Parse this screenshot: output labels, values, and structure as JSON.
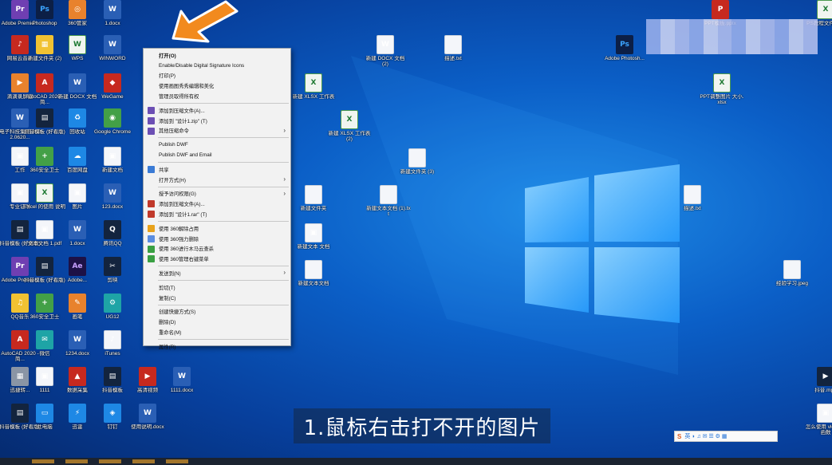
{
  "desktop_icons": [
    {
      "label": "Adobe Premie...",
      "glyph": "Pr",
      "style": "g-purple"
    },
    {
      "label": "网易云音乐",
      "glyph": "♪",
      "style": "g-red"
    },
    {
      "label": "滴滴录屏器",
      "glyph": "▶",
      "style": "g-orange"
    },
    {
      "label": "电子科技集团 2022.0620...",
      "glyph": "W",
      "style": "g-word"
    },
    {
      "label": "工作",
      "glyph": "▣",
      "style": "g-white"
    },
    {
      "label": "专业证书",
      "glyph": "▣",
      "style": "g-white"
    },
    {
      "label": "抖音模板 (好看版)",
      "glyph": "▤",
      "style": "g-dark"
    },
    {
      "label": "Adobe Premie...",
      "glyph": "Pr",
      "style": "g-purple"
    },
    {
      "label": "QQ音乐",
      "glyph": "♫",
      "style": "g-yellow"
    },
    {
      "label": "AutoCAD 2020 - 简...",
      "glyph": "A",
      "style": "g-red"
    },
    {
      "label": "迅捷转...",
      "glyph": "▦",
      "style": "g-gray"
    },
    {
      "label": "抖音模板 (好看版)",
      "glyph": "▤",
      "style": "g-dark"
    },
    {
      "label": "Photoshop",
      "glyph": "Ps",
      "style": "g-ps"
    },
    {
      "label": "新建文件夹 (2)",
      "glyph": "▦",
      "style": "g-yellow"
    },
    {
      "label": "AutoCAD 2020 - 简...",
      "glyph": "A",
      "style": "g-red"
    },
    {
      "label": "抖音模板 (好看版)",
      "glyph": "▤",
      "style": "g-dark"
    },
    {
      "label": "360安全卫士",
      "glyph": "+",
      "style": "g-green"
    },
    {
      "label": "Excel 的使用 说明",
      "glyph": "X",
      "style": "g-excel"
    },
    {
      "label": "文本文档 1.pdf",
      "glyph": "▣",
      "style": "g-white"
    },
    {
      "label": "抖音模板 (好看版)",
      "glyph": "▤",
      "style": "g-dark"
    },
    {
      "label": "360安全卫士",
      "glyph": "+",
      "style": "g-green"
    },
    {
      "label": "微信",
      "glyph": "✉",
      "style": "g-teal"
    },
    {
      "label": "1111",
      "glyph": "▣",
      "style": "g-white"
    },
    {
      "label": "此电脑",
      "glyph": "▭",
      "style": "g-blue"
    },
    {
      "label": "360管家",
      "glyph": "◎",
      "style": "g-orange"
    },
    {
      "label": "WPS",
      "glyph": "W",
      "style": "g-excel"
    },
    {
      "label": "新建 DOCX 文档",
      "glyph": "W",
      "style": "g-word"
    },
    {
      "label": "回收站",
      "glyph": "♻",
      "style": "g-blue"
    },
    {
      "label": "百度网盘",
      "glyph": "☁",
      "style": "g-blue"
    },
    {
      "label": "图片",
      "glyph": "▣",
      "style": "g-white"
    },
    {
      "label": "1.docx",
      "glyph": "W",
      "style": "g-word"
    },
    {
      "label": "Adobe...",
      "glyph": "Ae",
      "style": "g-ae"
    },
    {
      "label": "画笔",
      "glyph": "✎",
      "style": "g-orange"
    },
    {
      "label": "1234.docx",
      "glyph": "W",
      "style": "g-word"
    },
    {
      "label": "数据采集",
      "glyph": "▲",
      "style": "g-red"
    },
    {
      "label": "迅雷",
      "glyph": "⚡",
      "style": "g-blue"
    },
    {
      "label": "1.docx",
      "glyph": "W",
      "style": "g-word"
    },
    {
      "label": "WINWORD",
      "glyph": "W",
      "style": "g-word"
    },
    {
      "label": "WeGame",
      "glyph": "◆",
      "style": "g-red"
    },
    {
      "label": "Google Chrome",
      "glyph": "◉",
      "style": "g-green"
    },
    {
      "label": "新建文档",
      "glyph": "▣",
      "style": "g-white"
    },
    {
      "label": "123.docx",
      "glyph": "W",
      "style": "g-word"
    },
    {
      "label": "腾讯QQ",
      "glyph": "Q",
      "style": "g-dark"
    },
    {
      "label": "剪映",
      "glyph": "✂",
      "style": "g-dark"
    },
    {
      "label": "UG12",
      "glyph": "⚙",
      "style": "g-teal"
    },
    {
      "label": "iTunes",
      "glyph": "♪",
      "style": "g-white"
    },
    {
      "label": "抖音模板",
      "glyph": "▤",
      "style": "g-dark"
    },
    {
      "label": "钉钉",
      "glyph": "◈",
      "style": "g-blue"
    },
    {
      "label": "高清视频",
      "glyph": "▶",
      "style": "g-red"
    },
    {
      "label": "1111.docx",
      "glyph": "W",
      "style": "g-word"
    },
    {
      "label": "使用说明.docx",
      "glyph": "W",
      "style": "g-word"
    }
  ],
  "right_icons": [
    {
      "label": "PPT模板.pptx",
      "glyph": "P",
      "style": "g-red"
    },
    {
      "label": "PS教程文件.xlsx",
      "glyph": "X",
      "style": "g-excel"
    },
    {
      "label": "新建 DOCX 文档 (2)",
      "glyph": "W",
      "style": "g-white"
    },
    {
      "label": "新建 XLSX 工作表",
      "glyph": "X",
      "style": "g-excel"
    },
    {
      "label": "新建 XLSX 工作表 (2)",
      "glyph": "X",
      "style": "g-excel"
    },
    {
      "label": "新建文本 文档",
      "glyph": "▣",
      "style": "g-white"
    },
    {
      "label": "Adobe Photosh...",
      "glyph": "Ps",
      "style": "g-ps"
    },
    {
      "label": "PPT调整图片 大小.xlsx",
      "glyph": "X",
      "style": "g-excel"
    },
    {
      "label": "抖音.mp4",
      "glyph": "▶",
      "style": "g-dark"
    },
    {
      "label": "怎么使用 vlookup函数",
      "glyph": "▣",
      "style": "g-white"
    }
  ],
  "context_menu": {
    "items": [
      {
        "label": "打开(O)",
        "bold": true,
        "icon": "",
        "arrow": false
      },
      {
        "label": "Enable/Disable Digital Signature Icons",
        "bold": false,
        "icon": "",
        "arrow": false
      },
      {
        "label": "打印(P)",
        "bold": false,
        "icon": "",
        "arrow": false
      },
      {
        "label": "使用画图秀秀编辑和美化",
        "bold": false,
        "icon": "",
        "arrow": false
      },
      {
        "label": "管理员取得所有权",
        "bold": false,
        "icon": "",
        "arrow": false
      },
      {
        "sep": true
      },
      {
        "label": "添加到压缩文件(A)...",
        "bold": false,
        "icon": "#6c4fb4",
        "arrow": false
      },
      {
        "label": "添加到 \"设计1.zip\" (T)",
        "bold": false,
        "icon": "#6c4fb4",
        "arrow": false
      },
      {
        "label": "其他压缩命令",
        "bold": false,
        "icon": "#6c4fb4",
        "arrow": true
      },
      {
        "sep": true
      },
      {
        "label": "Publish DWF",
        "bold": false,
        "icon": "",
        "arrow": false
      },
      {
        "label": "Publish DWF and Email",
        "bold": false,
        "icon": "",
        "arrow": false
      },
      {
        "sep": true
      },
      {
        "label": "共享",
        "bold": false,
        "icon": "#3a7bd5",
        "arrow": false
      },
      {
        "label": "打开方式(H)",
        "bold": false,
        "icon": "",
        "arrow": true
      },
      {
        "sep": true
      },
      {
        "label": "授予访问权限(G)",
        "bold": false,
        "icon": "",
        "arrow": true
      },
      {
        "label": "添加到压缩文件(A)...",
        "bold": false,
        "icon": "#c0392b",
        "arrow": false
      },
      {
        "label": "添加到 \"设计1.rar\" (T)",
        "bold": false,
        "icon": "#c0392b",
        "arrow": false
      },
      {
        "sep": true
      },
      {
        "label": "使用 360解除占用",
        "bold": false,
        "icon": "#e8a21b",
        "arrow": false
      },
      {
        "label": "使用 360强力删除",
        "bold": false,
        "icon": "#5b8de0",
        "arrow": false
      },
      {
        "label": "使用 360进行木马云查杀",
        "bold": false,
        "icon": "#3aa043",
        "arrow": false
      },
      {
        "label": "使用 360管理右键菜单",
        "bold": false,
        "icon": "#3aa043",
        "arrow": false
      },
      {
        "sep": true
      },
      {
        "label": "发送到(N)",
        "bold": false,
        "icon": "",
        "arrow": true
      },
      {
        "sep": true
      },
      {
        "label": "剪切(T)",
        "bold": false,
        "icon": "",
        "arrow": false
      },
      {
        "label": "复制(C)",
        "bold": false,
        "icon": "",
        "arrow": false
      },
      {
        "sep": true
      },
      {
        "label": "创建快捷方式(S)",
        "bold": false,
        "icon": "",
        "arrow": false
      },
      {
        "label": "删除(D)",
        "bold": false,
        "icon": "",
        "arrow": false
      },
      {
        "label": "重命名(M)",
        "bold": false,
        "icon": "",
        "arrow": false
      },
      {
        "sep": true
      },
      {
        "label": "属性(R)",
        "bold": false,
        "icon": "",
        "arrow": false
      }
    ]
  },
  "caption": {
    "text": "1.鼠标右击打不开的图片"
  },
  "ime": {
    "text": "英 ◗ ♫ ✉ ☰ ⚙ ▦"
  },
  "colors": {
    "wallpaper": "#0b5fc7",
    "arrow": "#f28a1e",
    "menu_bg": "#f2f2f2"
  }
}
